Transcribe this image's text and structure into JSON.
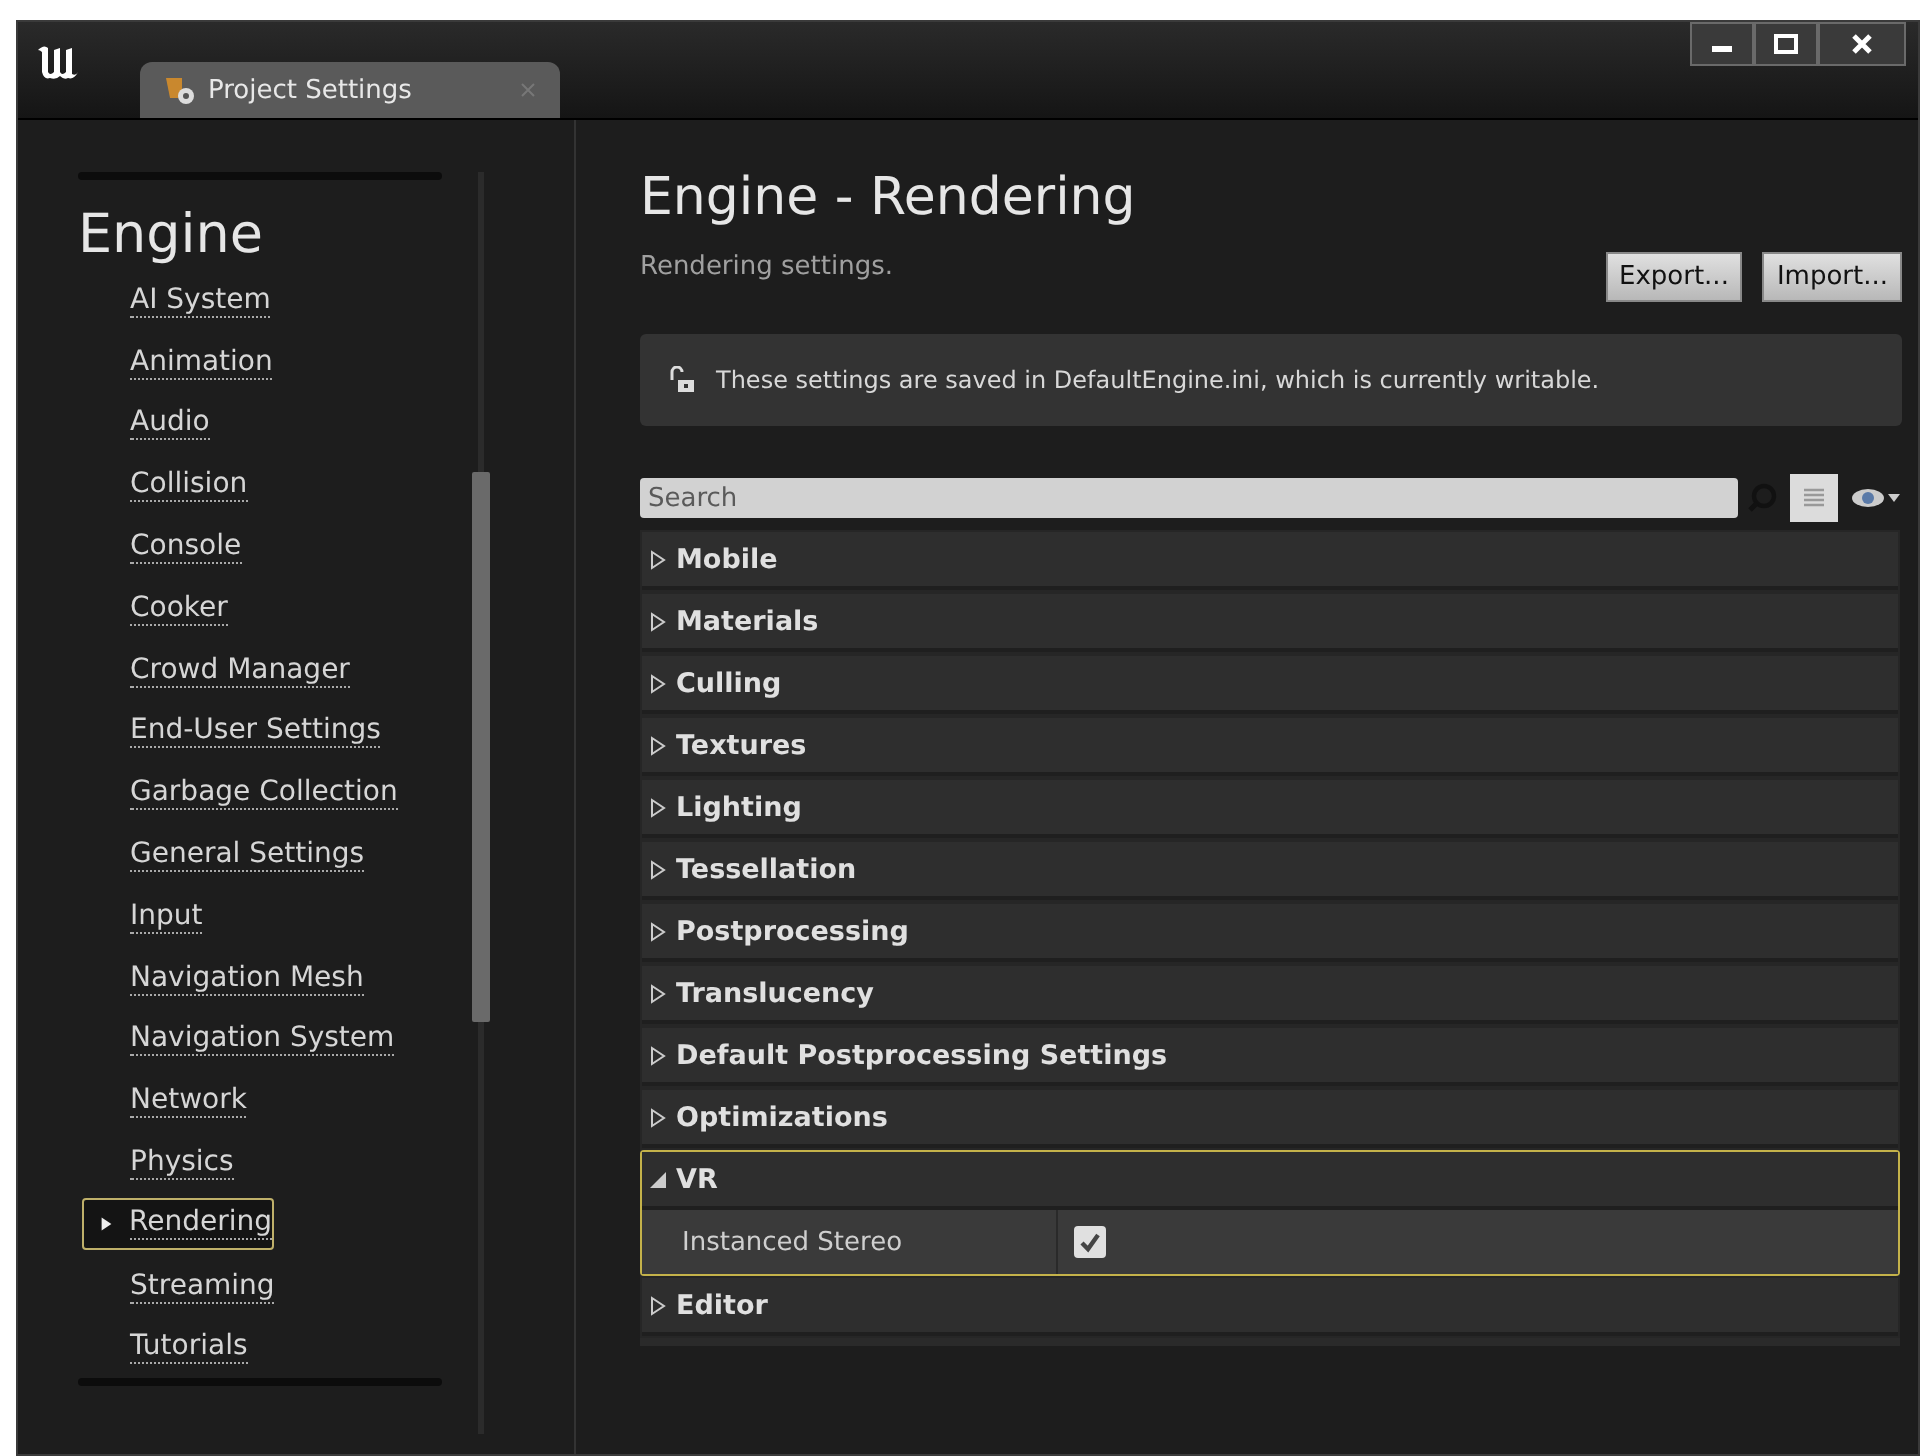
{
  "window": {
    "title": "Project Settings"
  },
  "sidebar": {
    "heading": "Engine",
    "items": [
      {
        "label": "AI System",
        "selected": false
      },
      {
        "label": "Animation",
        "selected": false
      },
      {
        "label": "Audio",
        "selected": false
      },
      {
        "label": "Collision",
        "selected": false
      },
      {
        "label": "Console",
        "selected": false
      },
      {
        "label": "Cooker",
        "selected": false
      },
      {
        "label": "Crowd Manager",
        "selected": false
      },
      {
        "label": "End-User Settings",
        "selected": false
      },
      {
        "label": "Garbage Collection",
        "selected": false
      },
      {
        "label": "General Settings",
        "selected": false
      },
      {
        "label": "Input",
        "selected": false
      },
      {
        "label": "Navigation Mesh",
        "selected": false
      },
      {
        "label": "Navigation System",
        "selected": false
      },
      {
        "label": "Network",
        "selected": false
      },
      {
        "label": "Physics",
        "selected": false
      },
      {
        "label": "Rendering",
        "selected": true
      },
      {
        "label": "Streaming",
        "selected": false
      },
      {
        "label": "Tutorials",
        "selected": false
      }
    ]
  },
  "page": {
    "title": "Engine - Rendering",
    "subtitle": "Rendering settings.",
    "buttons": [
      "Export...",
      "Import..."
    ],
    "notice": "These settings are saved in DefaultEngine.ini, which is currently writable.",
    "search": {
      "placeholder": "Search"
    }
  },
  "categories": [
    {
      "label": "Mobile",
      "expanded": false,
      "selected": false
    },
    {
      "label": "Materials",
      "expanded": false,
      "selected": false
    },
    {
      "label": "Culling",
      "expanded": false,
      "selected": false
    },
    {
      "label": "Textures",
      "expanded": false,
      "selected": false
    },
    {
      "label": "Lighting",
      "expanded": false,
      "selected": false
    },
    {
      "label": "Tessellation",
      "expanded": false,
      "selected": false
    },
    {
      "label": "Postprocessing",
      "expanded": false,
      "selected": false
    },
    {
      "label": "Translucency",
      "expanded": false,
      "selected": false
    },
    {
      "label": "Default Postprocessing Settings",
      "expanded": false,
      "selected": false
    },
    {
      "label": "Optimizations",
      "expanded": false,
      "selected": false
    },
    {
      "label": "VR",
      "expanded": true,
      "selected": true,
      "properties": [
        {
          "label": "Instanced Stereo",
          "checked": true
        }
      ]
    },
    {
      "label": "Editor",
      "expanded": false,
      "selected": false
    }
  ]
}
